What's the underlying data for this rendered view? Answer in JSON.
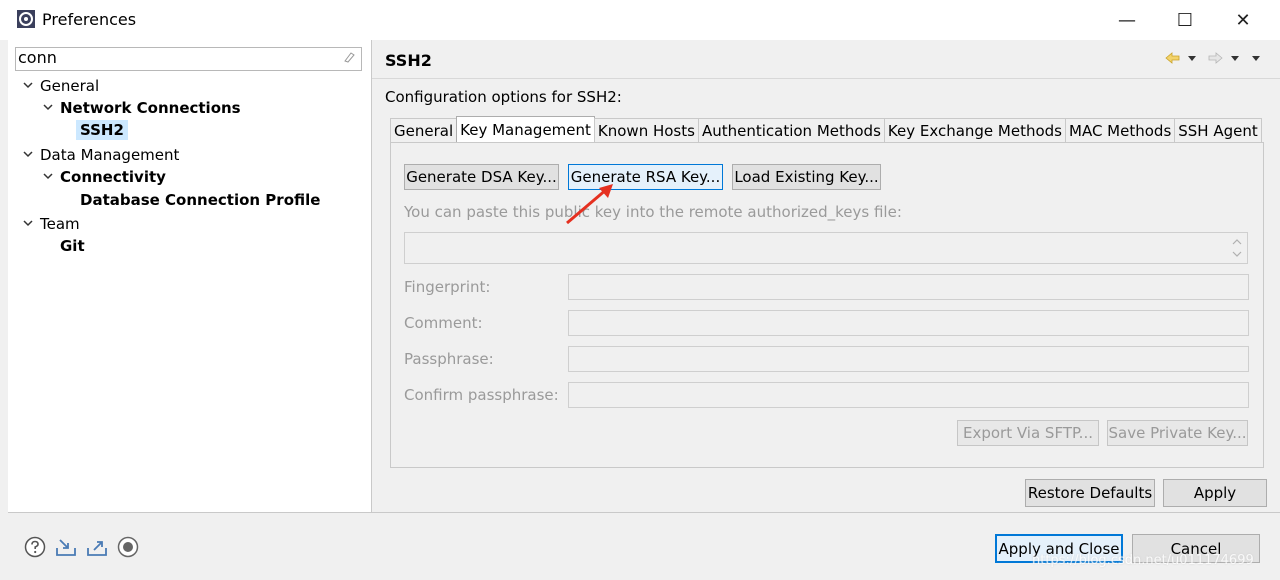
{
  "window": {
    "title": "Preferences",
    "controls": {
      "minimize": "—",
      "maximize": "☐",
      "close": "✕"
    }
  },
  "filter": {
    "value": "conn"
  },
  "tree": {
    "general": "General",
    "network_connections": "Network Connections",
    "ssh2": "SSH2",
    "data_management": "Data Management",
    "connectivity": "Connectivity",
    "db_connection_profile": "Database Connection Profile",
    "team": "Team",
    "git": "Git"
  },
  "page": {
    "title": "SSH2",
    "config_label": "Configuration options for SSH2:"
  },
  "tabs": [
    "General",
    "Key Management",
    "Known Hosts",
    "Authentication Methods",
    "Key Exchange Methods",
    "MAC Methods",
    "SSH Agent"
  ],
  "key_management": {
    "gen_dsa": "Generate DSA Key...",
    "gen_rsa": "Generate RSA Key...",
    "load_key": "Load Existing Key...",
    "paste_hint": "You can paste this public key into the remote authorized_keys file:",
    "fingerprint": "Fingerprint:",
    "comment": "Comment:",
    "passphrase": "Passphrase:",
    "confirm_passphrase": "Confirm passphrase:",
    "export_sftp": "Export Via SFTP...",
    "save_private": "Save Private Key..."
  },
  "buttons": {
    "restore_defaults": "Restore Defaults",
    "apply": "Apply",
    "apply_close": "Apply and Close",
    "cancel": "Cancel"
  },
  "watermark": "https://blog.csdn.net/u011174699",
  "colors": {
    "accent": "#0078d7",
    "selection": "#cce8ff",
    "arrow": "#e53020"
  }
}
